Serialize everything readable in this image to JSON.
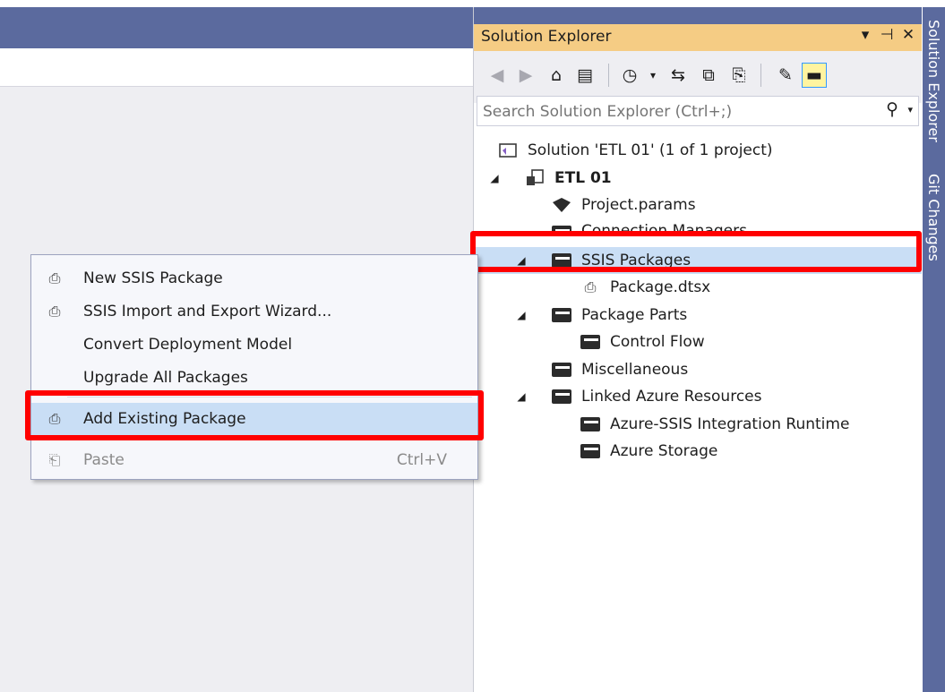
{
  "solution_explorer": {
    "title": "Solution Explorer",
    "title_buttons": {
      "dropdown": "▾",
      "pin": "⊣",
      "close": "✕"
    },
    "search_placeholder": "Search Solution Explorer (Ctrl+;)",
    "tree": [
      {
        "label": "Solution 'ETL 01' (1 of 1 project)"
      },
      {
        "label": "ETL 01"
      },
      {
        "label": "Project.params"
      },
      {
        "label": "Connection Managers"
      },
      {
        "label": "SSIS Packages"
      },
      {
        "label": "Package.dtsx"
      },
      {
        "label": "Package Parts"
      },
      {
        "label": "Control Flow"
      },
      {
        "label": "Miscellaneous"
      },
      {
        "label": "Linked Azure Resources"
      },
      {
        "label": "Azure-SSIS Integration Runtime"
      },
      {
        "label": "Azure Storage"
      }
    ]
  },
  "side_tabs": [
    "Solution Explorer",
    "Git Changes"
  ],
  "context_menu": {
    "items": [
      {
        "label": "New SSIS Package",
        "shortcut": ""
      },
      {
        "label": "SSIS Import and Export Wizard...",
        "shortcut": ""
      },
      {
        "label": "Convert Deployment Model",
        "shortcut": ""
      },
      {
        "label": "Upgrade All Packages",
        "shortcut": ""
      },
      {
        "label": "Add Existing Package",
        "shortcut": ""
      },
      {
        "label": "Paste",
        "shortcut": "Ctrl+V"
      }
    ]
  },
  "colors": {
    "titlebar": "#5b6a9e",
    "active_title": "#f5cc84",
    "selection": "#c9def5",
    "highlight_box": "#ff0000"
  }
}
